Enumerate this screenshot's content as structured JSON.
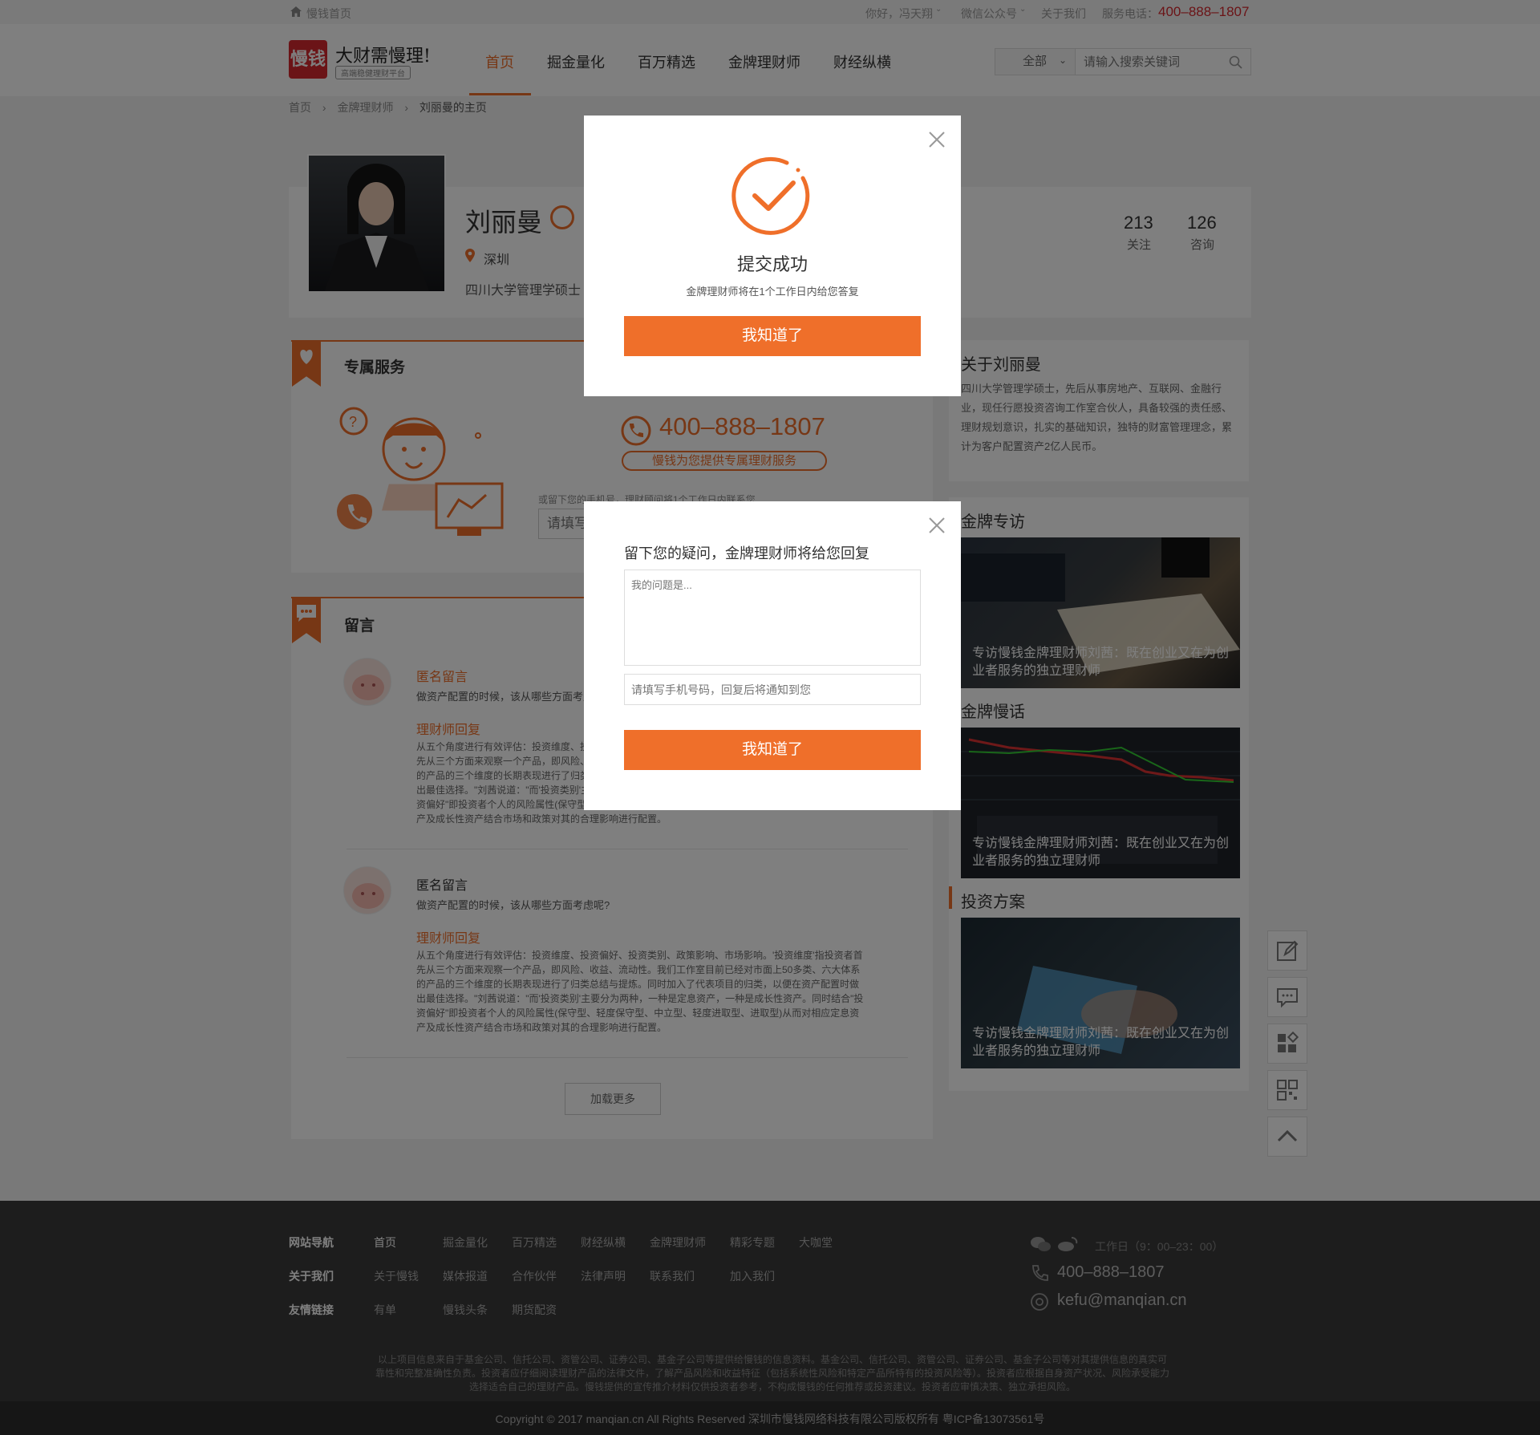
{
  "topbar": {
    "home_link": "慢钱首页",
    "greeting": "你好，冯天翔",
    "wechat": "微信公众号",
    "about": "关于我们",
    "hotline_label": "服务电话：",
    "hotline": "400–888–1807"
  },
  "header": {
    "logo_text": "慢钱",
    "slogan": "大财需慢理!",
    "slogan_sub": "高端稳健理财平台",
    "nav": [
      "首页",
      "掘金量化",
      "百万精选",
      "金牌理财师",
      "财经纵横"
    ],
    "search_scope": "全部",
    "search_placeholder": "请输入搜索关键词"
  },
  "breadcrumb": [
    "首页",
    "金牌理财师",
    "刘丽曼的主页"
  ],
  "profile": {
    "name": "刘丽曼",
    "location": "深圳",
    "education": "四川大学管理学硕士",
    "stats": [
      {
        "value": "213",
        "label": "关注"
      },
      {
        "value": "126",
        "label": "咨询"
      }
    ]
  },
  "service": {
    "title": "专属服务",
    "phone": "400–888–1807",
    "tagline": "慢钱为您提供专属理财服务",
    "note": "或留下您的手机号，理财顾问将1个工作日内联系您",
    "input_placeholder": "请填写"
  },
  "messages": {
    "title": "留言",
    "items": [
      {
        "author": "匿名留言",
        "question": "做资产配置的时候，该从哪些方面考虑呢?",
        "reply_label": "理财师回复",
        "reply": "从五个角度进行有效评估：投资维度、投资偏好、投资类别、政策影响、市场影响。'投资维度'指投资者首先从三个方面来观察一个产品，即风险、收益、流动性。我们工作室目前已经对市面上50多类、六大体系的产品的三个维度的长期表现进行了归类总结与提炼。同时加入了代表项目的归类，以便在资产配置时做出最佳选择。\"刘茜说道：\"而'投资类别'主要分为两种，一种是定息资产，一种是成长性资产。同时结合\"投资偏好\"即投资者个人的风险属性(保守型、轻度保守型、中立型、轻度进取型、进取型)从而对相应定息资产及成长性资产结合市场和政策对其的合理影响进行配置。"
      },
      {
        "author": "匿名留言",
        "question": "做资产配置的时候，该从哪些方面考虑呢?",
        "reply_label": "理财师回复",
        "reply": "从五个角度进行有效评估：投资维度、投资偏好、投资类别、政策影响、市场影响。'投资维度'指投资者首先从三个方面来观察一个产品，即风险、收益、流动性。我们工作室目前已经对市面上50多类、六大体系的产品的三个维度的长期表现进行了归类总结与提炼。同时加入了代表项目的归类，以便在资产配置时做出最佳选择。\"刘茜说道：\"而'投资类别'主要分为两种，一种是定息资产，一种是成长性资产。同时结合\"投资偏好\"即投资者个人的风险属性(保守型、轻度保守型、中立型、轻度进取型、进取型)从而对相应定息资产及成长性资产结合市场和政策对其的合理影响进行配置。"
      }
    ],
    "load_more": "加载更多"
  },
  "about": {
    "title": "关于刘丽曼",
    "text": "四川大学管理学硕士，先后从事房地产、互联网、金融行业，现任行愿投资咨询工作室合伙人，具备较强的责任感、理财规划意识，扎实的基础知识，独特的财富管理理念，累计为客户配置资产2亿人民币。"
  },
  "sidebar_sections": [
    {
      "title": "金牌专访",
      "caption": "专访慢钱金牌理财师刘茜：既在创业又在为创业者服务的独立理财师"
    },
    {
      "title": "金牌慢话",
      "caption": "专访慢钱金牌理财师刘茜：既在创业又在为创业者服务的独立理财师"
    },
    {
      "title": "投资方案",
      "caption": "专访慢钱金牌理财师刘茜：既在创业又在为创业者服务的独立理财师"
    }
  ],
  "footer": {
    "rows": [
      {
        "heading": "网站导航",
        "links": [
          "首页",
          "掘金量化",
          "百万精选",
          "财经纵横",
          "金牌理财师",
          "精彩专题",
          "大咖堂"
        ]
      },
      {
        "heading": "关于我们",
        "links": [
          "关于慢钱",
          "媒体报道",
          "合作伙伴",
          "法律声明",
          "联系我们",
          "加入我们"
        ]
      },
      {
        "heading": "友情链接",
        "links": [
          "有单",
          "慢钱头条",
          "期货配资"
        ]
      }
    ],
    "hours": "工作日（9：00–23：00）",
    "phone": "400–888–1807",
    "email": "kefu@manqian.cn",
    "disclaimer": "以上项目信息来自于基金公司、信托公司、资管公司、证券公司、基金子公司等提供给慢钱的信息资料。基金公司、信托公司、资管公司、证券公司、基金子公司等对其提供信息的真实可靠性和完整准确性负责。投资者应仔细阅读理财产品的法律文件，了解产品风险和收益特征（包括系统性风险和特定产品所特有的投资风险等）。投资者应根据自身资产状况、风险承受能力选择适合自己的理财产品。慢钱提供的宣传推介材料仅供投资者参考，不构成慢钱的任何推荐或投资建议。投资者应审慎决策、独立承担风险。",
    "copyright": "Copyright © 2017 manqian.cn All Rights Reserved 深圳市慢钱网络科技有限公司版权所有 粤ICP备13073561号"
  },
  "modal_success": {
    "title": "提交成功",
    "subtitle": "金牌理财师将在1个工作日内给您答复",
    "button": "我知道了"
  },
  "modal_question": {
    "title": "留下您的疑问，金牌理财师将给您回复",
    "question_placeholder": "我的问题是...",
    "phone_placeholder": "请填写手机号码，回复后将通知到您",
    "button": "我知道了"
  },
  "colors": {
    "accent": "#ef6f2a",
    "brand_red": "#d7282f",
    "footer_bg": "#3a3a3a"
  }
}
